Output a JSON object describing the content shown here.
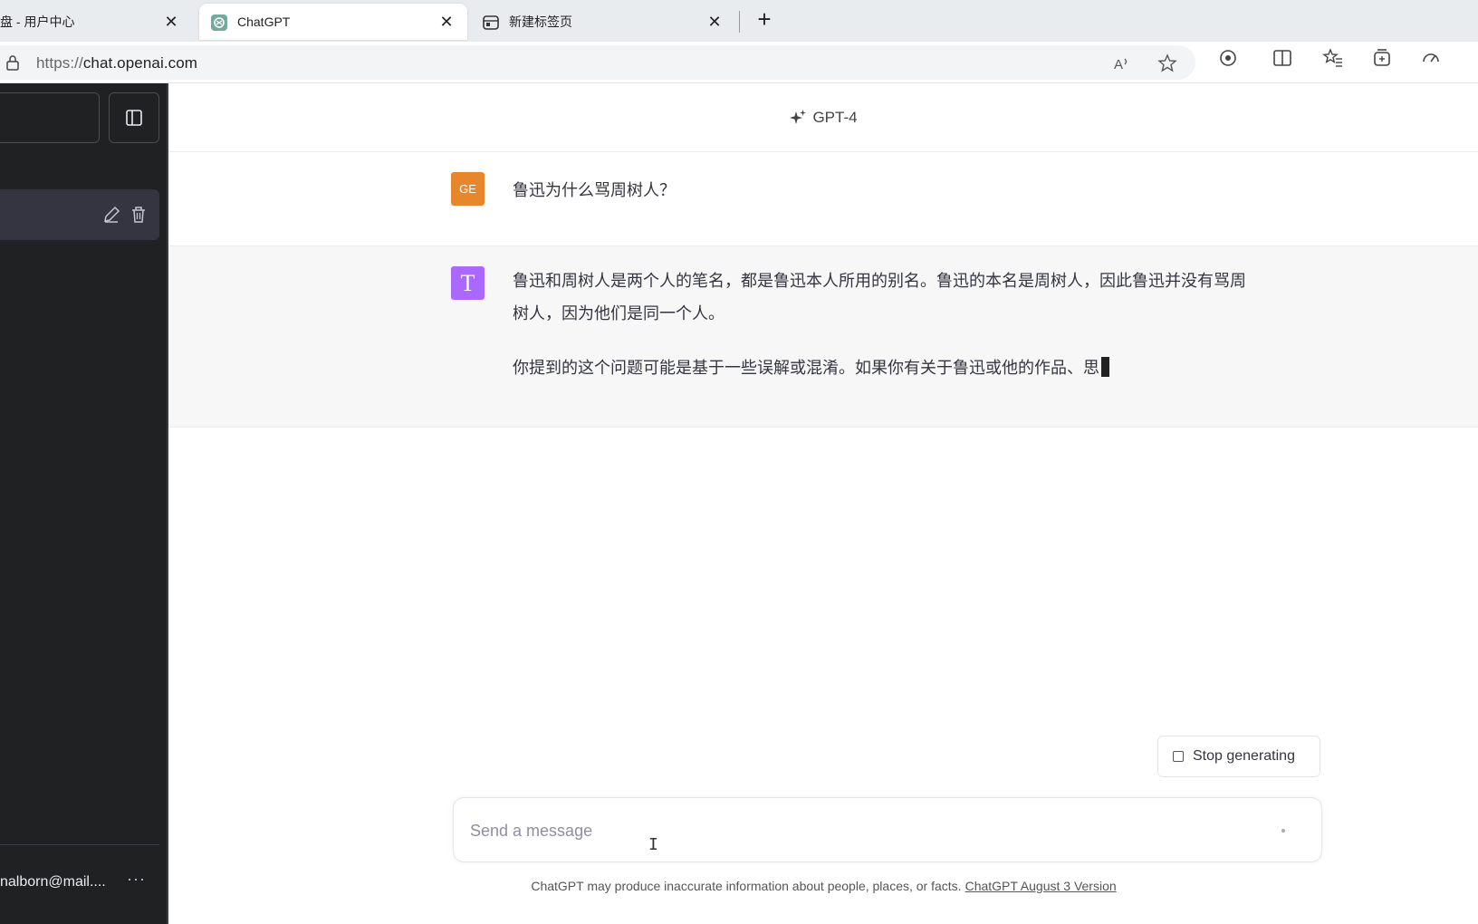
{
  "browser": {
    "tabs": [
      {
        "title": "盘 - 用户中心",
        "close": "✕"
      },
      {
        "title": "ChatGPT",
        "close": "✕"
      },
      {
        "title": "新建标签页",
        "close": "✕"
      }
    ],
    "new_tab": "+",
    "url_scheme": "https://",
    "url_host": "chat.openai.com"
  },
  "sidebar": {
    "user_email": "nalborn@mail....",
    "more_label": "···"
  },
  "header": {
    "model": "GPT-4"
  },
  "conversation": {
    "user_avatar": "GE",
    "user_message": "鲁迅为什么骂周树人？",
    "bot_avatar": "T",
    "bot_paragraph_1": "鲁迅和周树人是两个人的笔名，都是鲁迅本人所用的别名。鲁迅的本名是周树人，因此鲁迅并没有骂周树人，因为他们是同一个人。",
    "bot_paragraph_2": "你提到的这个问题可能是基于一些误解或混淆。如果你有关于鲁迅或他的作品、思"
  },
  "composer": {
    "stop_label": "Stop generating",
    "placeholder": "Send a message",
    "disclaimer": "ChatGPT may produce inaccurate information about people, places, or facts.",
    "version_link": "ChatGPT August 3 Version"
  }
}
